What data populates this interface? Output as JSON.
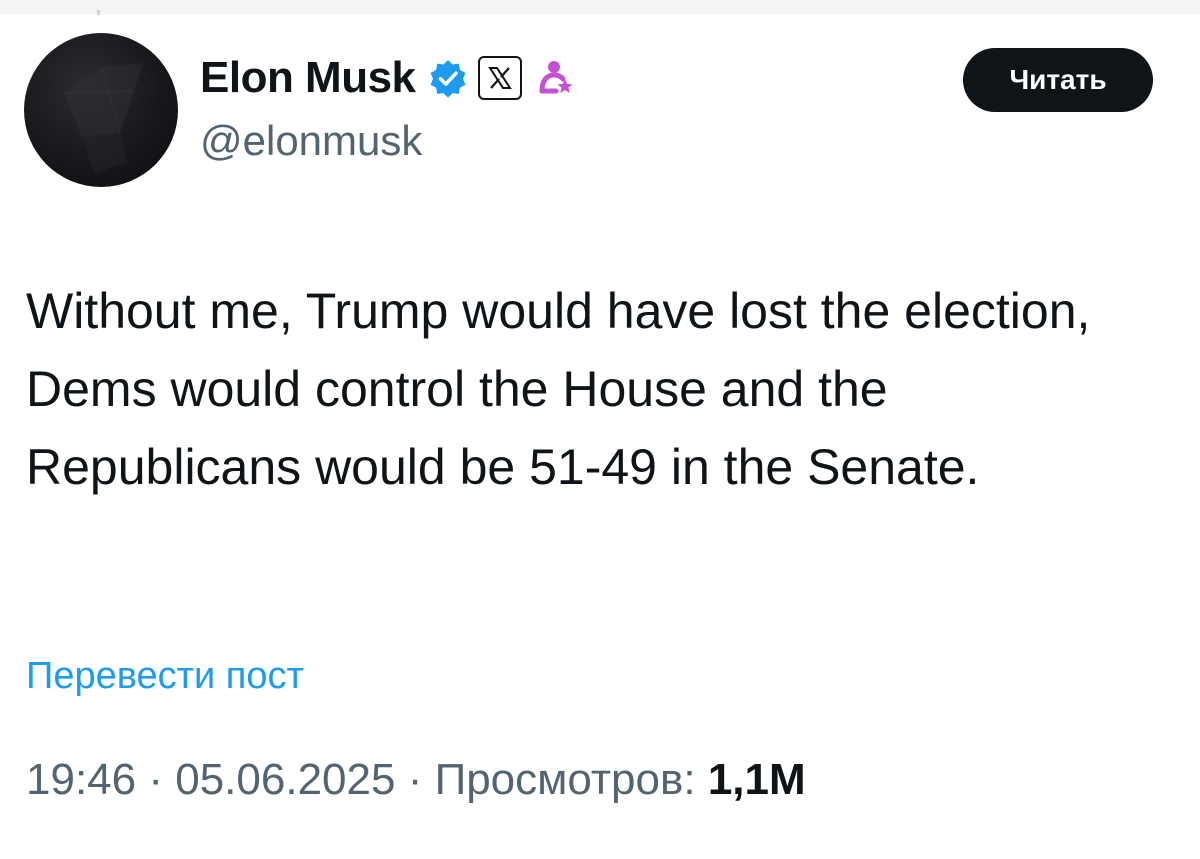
{
  "author": {
    "display_name": "Elon Musk",
    "handle": "@elonmusk",
    "verified_color": "#1d9bf0",
    "badges": [
      "verified-checkmark-icon",
      "x-logo-icon",
      "government-affiliation-icon"
    ]
  },
  "actions": {
    "follow_label": "Читать"
  },
  "post": {
    "text": "Without me, Trump would have lost the election, Dems would control the House and the Republicans would be 51-49 in the Senate.",
    "translate_label": "Перевести пост"
  },
  "meta": {
    "time": "19:46",
    "separator": "·",
    "date": "05.06.2025",
    "views_label": "Просмотров:",
    "views_count": "1,1M"
  },
  "colors": {
    "text": "#0f1419",
    "secondary": "#536471",
    "link": "#1d9bf0",
    "button_bg": "#0f1419",
    "gov_badge": "#c64fd6"
  }
}
